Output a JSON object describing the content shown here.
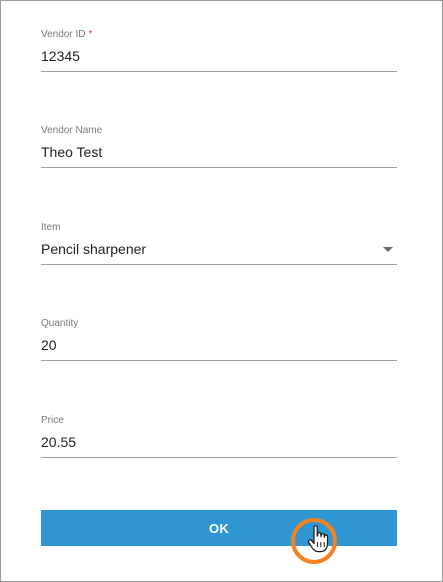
{
  "form": {
    "fields": [
      {
        "label": "Vendor ID",
        "required_mark": "*",
        "value": "12345"
      },
      {
        "label": "Vendor Name",
        "value": "Theo Test"
      },
      {
        "label": "Item",
        "value": "Pencil sharpener"
      },
      {
        "label": "Quantity",
        "value": "20"
      },
      {
        "label": "Price",
        "value": "20.55"
      }
    ],
    "ok_label": "OK"
  },
  "colors": {
    "button": "#2f96d2",
    "highlight_ring": "#f58220",
    "required": "#e53935"
  },
  "icons": {
    "dropdown": "dropdown-arrow-icon",
    "cursor": "hand-pointer-icon"
  }
}
